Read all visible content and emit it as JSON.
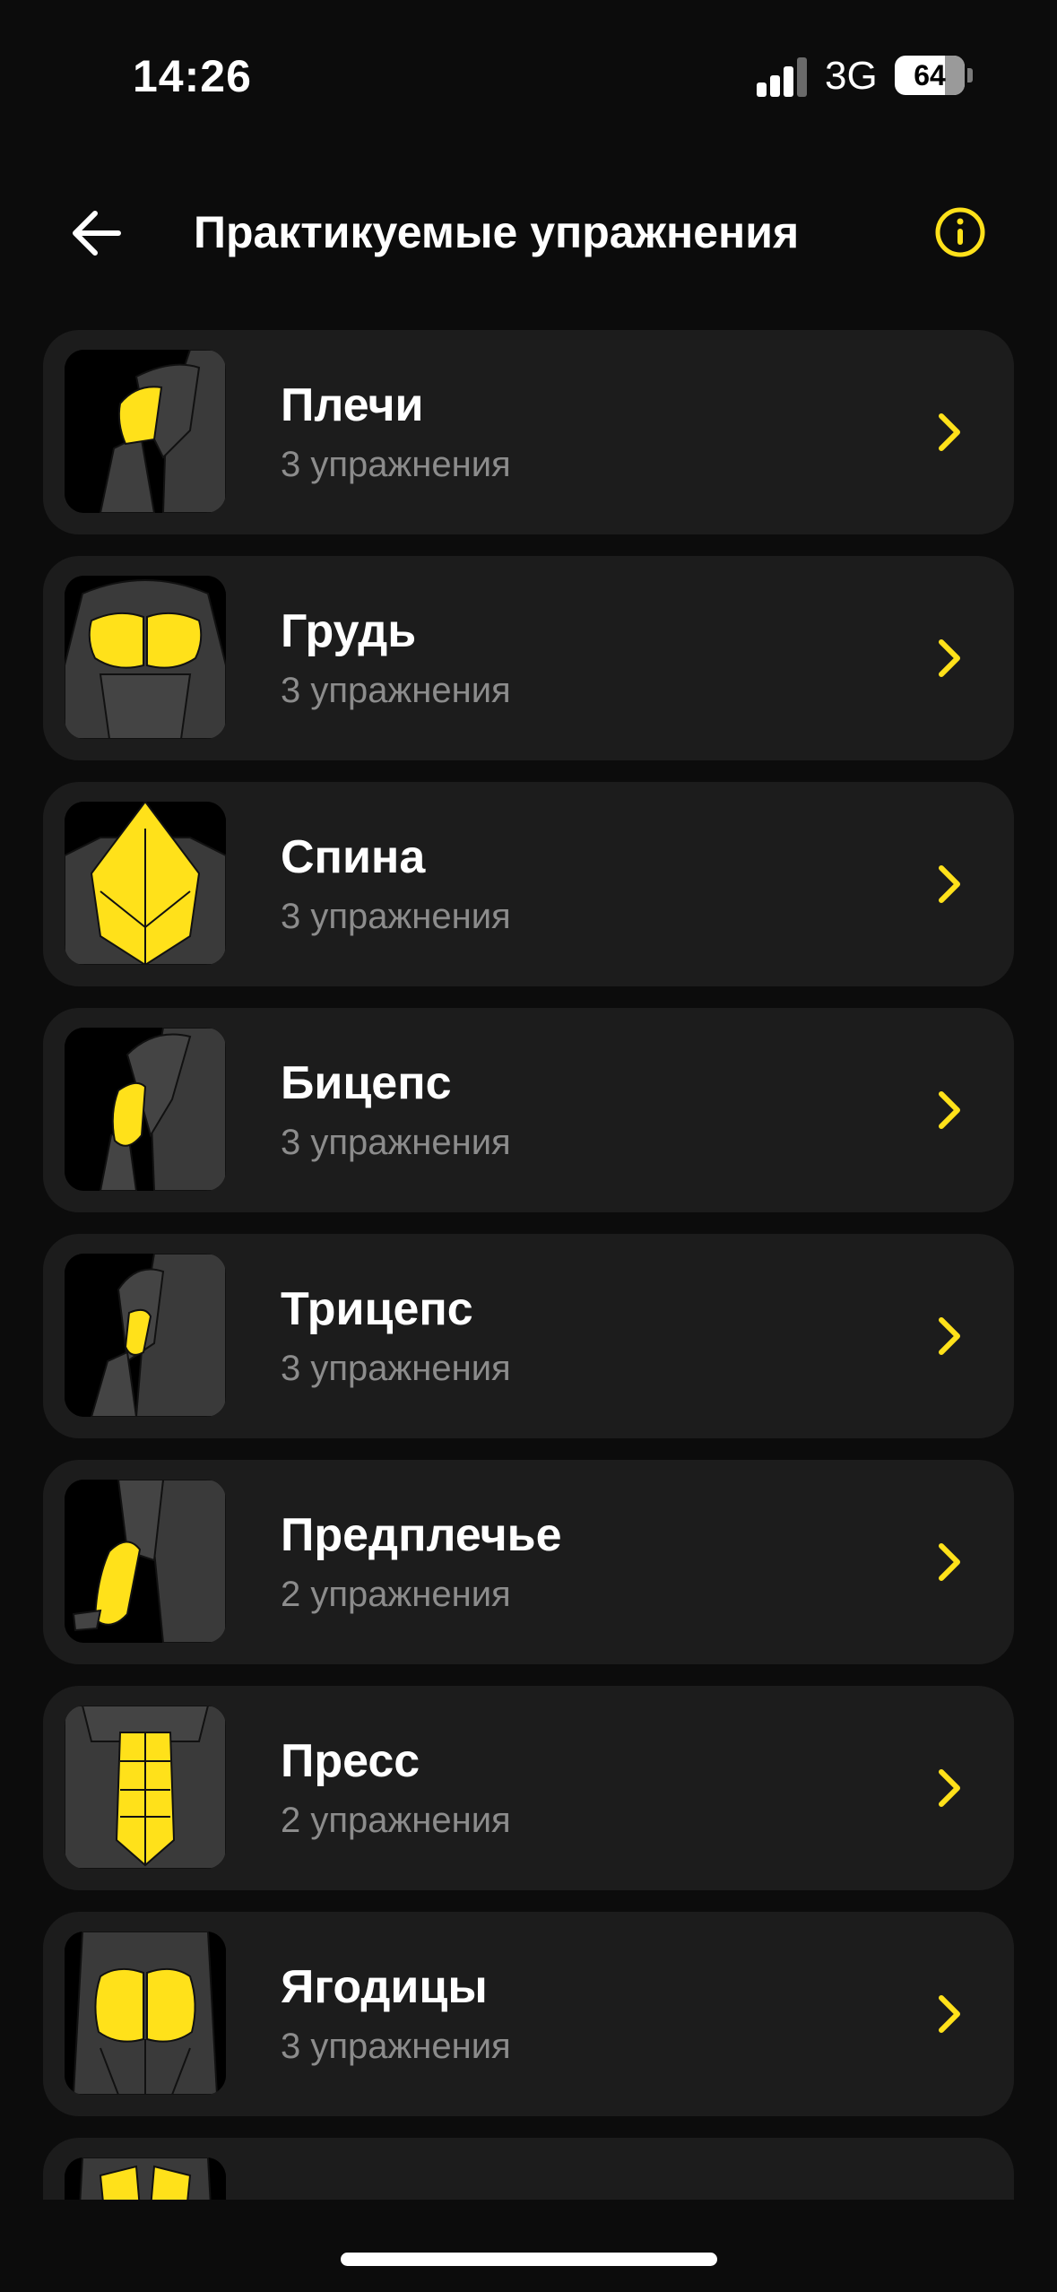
{
  "status_bar": {
    "time": "14:26",
    "network": "3G",
    "battery": "64"
  },
  "header": {
    "title": "Практикуемые упражнения",
    "back_icon": "arrow-left-icon",
    "info_icon": "info-icon"
  },
  "colors": {
    "accent": "#ffe11a",
    "card_bg": "#1c1c1c",
    "background": "#0c0c0c",
    "subtitle": "#8c8c8c"
  },
  "muscle_groups": [
    {
      "name": "Плечи",
      "count": "3 упражнения",
      "icon": "shoulders-icon"
    },
    {
      "name": "Грудь",
      "count": "3 упражнения",
      "icon": "chest-icon"
    },
    {
      "name": "Спина",
      "count": "3 упражнения",
      "icon": "back-icon"
    },
    {
      "name": "Бицепс",
      "count": "3 упражнения",
      "icon": "biceps-icon"
    },
    {
      "name": "Трицепс",
      "count": "3 упражнения",
      "icon": "triceps-icon"
    },
    {
      "name": "Предплечье",
      "count": "2 упражнения",
      "icon": "forearm-icon"
    },
    {
      "name": "Пресс",
      "count": "2 упражнения",
      "icon": "abs-icon"
    },
    {
      "name": "Ягодицы",
      "count": "3 упражнения",
      "icon": "glutes-icon"
    },
    {
      "name": "",
      "count": "",
      "icon": "legs-icon"
    }
  ]
}
